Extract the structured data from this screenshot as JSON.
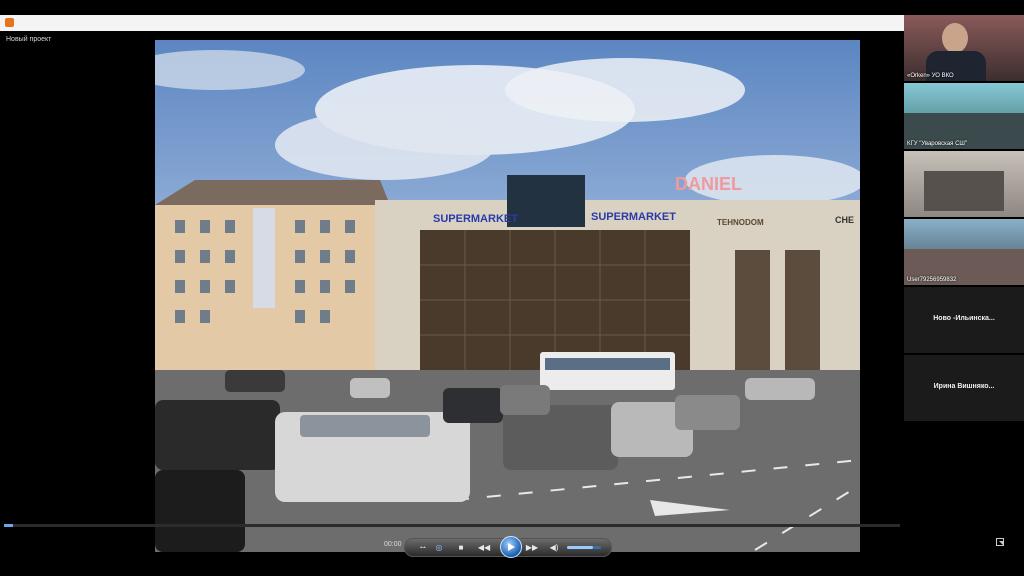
{
  "window": {
    "project_title": "Новый проект"
  },
  "player": {
    "time": "00:00",
    "progress": 0.01,
    "volume": 0.75,
    "video_signs": [
      "SUPERMARKET",
      "SUPERMARKET",
      "DANIEL",
      "TEHNODOM",
      "CHE"
    ]
  },
  "participants": [
    {
      "label": "«Orken» УО ВКО",
      "type": "video"
    },
    {
      "label": "КГУ \"Уваровская СШ\"",
      "type": "video"
    },
    {
      "label": "",
      "type": "video"
    },
    {
      "label": "User79256959832",
      "type": "video"
    },
    {
      "label": "Ново  -Ильинска...",
      "type": "name"
    },
    {
      "label": "Ирина  Вишняко...",
      "type": "name"
    }
  ],
  "colors": {
    "seek_fill": "#6aa6e8",
    "play_button": "#1a5fb0",
    "app_icon": "#e8731c"
  },
  "icons": [
    "app-icon",
    "bookmark-icon",
    "loop-icon",
    "stop-icon",
    "rewind-icon",
    "play-icon",
    "fast-forward-icon",
    "volume-icon",
    "fullscreen-icon"
  ]
}
